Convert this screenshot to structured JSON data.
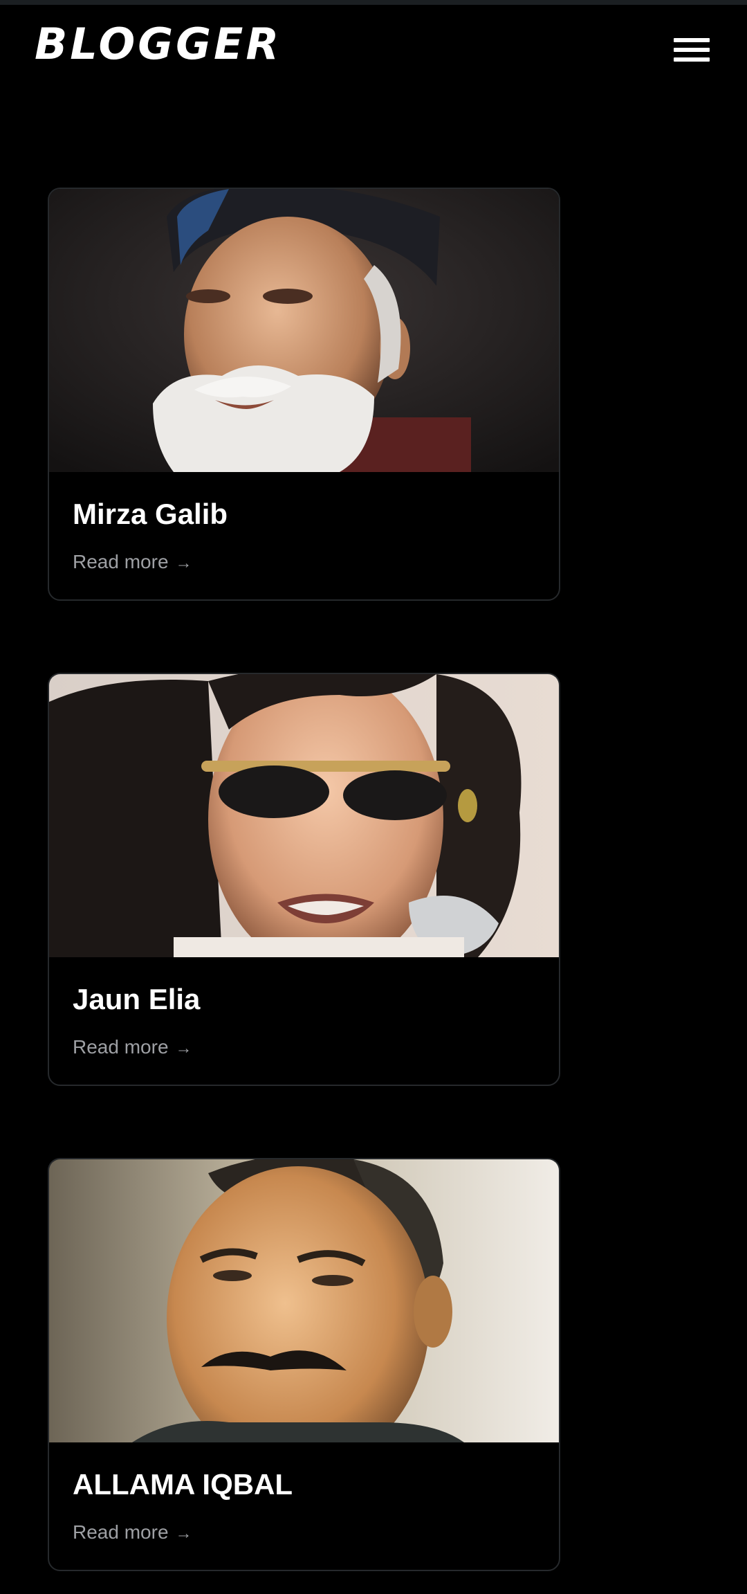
{
  "app": {
    "brand": "BLOGGER",
    "menu_icon": "hamburger-menu-icon"
  },
  "colors": {
    "background": "#000000",
    "card_border": "#26292c",
    "title": "#ffffff",
    "link": "#9ea0a4"
  },
  "posts": [
    {
      "title": "Mirza Galib",
      "link_label": "Read more",
      "link_arrow": "→",
      "image": "portrait-photo"
    },
    {
      "title": "Jaun Elia",
      "link_label": "Read more",
      "link_arrow": "→",
      "image": "portrait-photo"
    },
    {
      "title": "ALLAMA IQBAL",
      "link_label": "Read more",
      "link_arrow": "→",
      "image": "portrait-photo"
    }
  ]
}
